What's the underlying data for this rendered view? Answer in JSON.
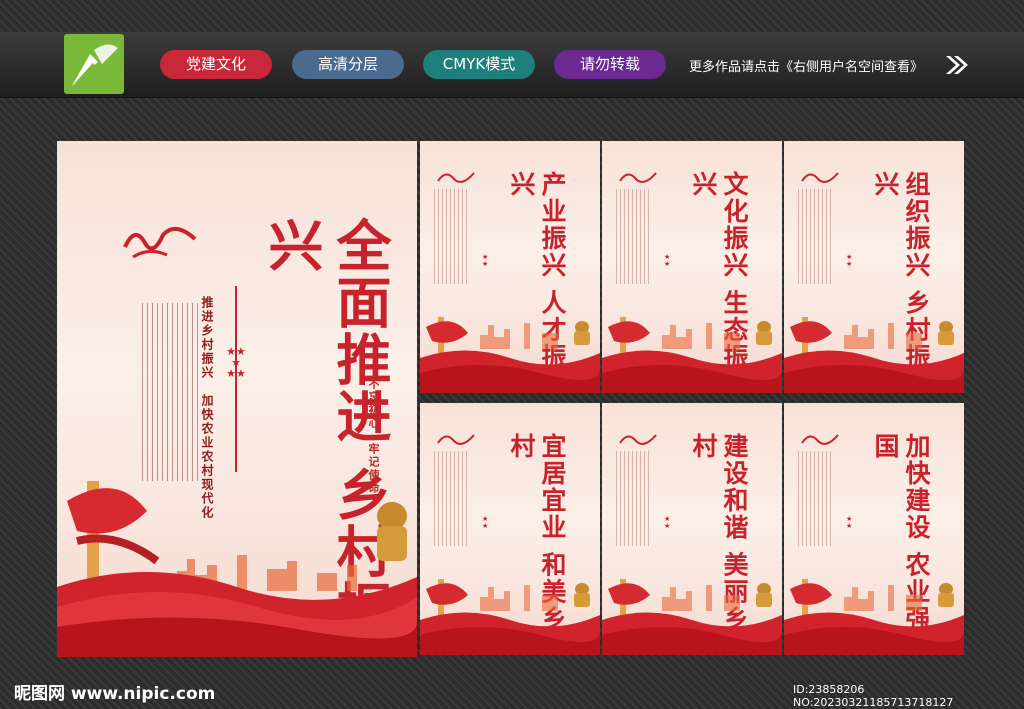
{
  "toolbar": {
    "tags": [
      "党建文化",
      "高清分层",
      "CMYK模式",
      "请勿转载"
    ],
    "note": "更多作品请点击《右侧用户名空间查看》"
  },
  "colors": {
    "accent_red": "#c7232d",
    "tag_red": "#c9283a",
    "tag_blue": "#4a6a8e",
    "tag_teal": "#1f7f7c",
    "tag_purple": "#6a2a92"
  },
  "main_poster": {
    "title_line1": "全面推进",
    "title_line2": "乡村振兴",
    "subtitle": "推进乡村振兴　加快农业农村现代化",
    "seal": "不忘初心　牢记使命"
  },
  "posters": [
    {
      "title_line1": "产业振兴",
      "title_line2": "人才振兴"
    },
    {
      "title_line1": "文化振兴",
      "title_line2": "生态振兴"
    },
    {
      "title_line1": "组织振兴",
      "title_line2": "乡村振兴"
    },
    {
      "title_line1": "宜居宜业",
      "title_line2": "和美乡村"
    },
    {
      "title_line1": "建设和谐",
      "title_line2": "美丽乡村"
    },
    {
      "title_line1": "加快建设",
      "title_line2": "农业强国"
    }
  ],
  "footer": {
    "site": "昵图网 www.nipic.com",
    "id": "ID:23858206 NO:20230321185713718127"
  }
}
